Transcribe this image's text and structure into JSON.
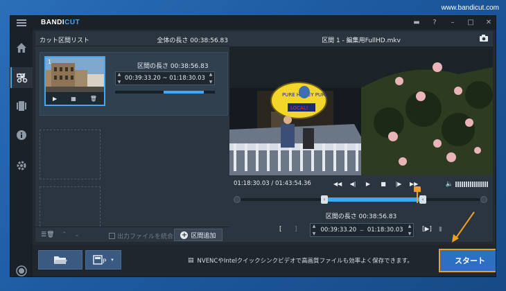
{
  "watermark": "www.bandicut.com",
  "app": {
    "logo_a": "BANDI",
    "logo_b": "CUT"
  },
  "sidebar": [
    "home-icon",
    "cut-icon",
    "film-icon",
    "info-icon",
    "gear-icon",
    "record-icon"
  ],
  "left_panel": {
    "title": "カット区間リスト",
    "total_length": "全体の長さ 00:38:56.83",
    "clip": {
      "index": "1",
      "length_label": "区間の長さ 00:38:56.83",
      "time_range": "00:39:33.20 ~ 01:18:30.03",
      "progress": 0.4
    },
    "merge_label": "出力ファイルを統合",
    "add_label": "区間追加"
  },
  "player": {
    "title": "区間 1 - 編集用FullHD.mkv",
    "position": "01:18:30.03 / 01:43:54.36",
    "segment_length": "区間の長さ 00:38:56.83",
    "segment_start": "00:39:33.20",
    "segment_end": "01:18:30.03",
    "sign_top": "PURE HONEY PURE",
    "sign_bottom": "LOCAL!"
  },
  "bottom": {
    "tip": "NVENCやIntelクイックシンクビデオで高画質ファイルも効率よく保存できます。",
    "start_label": "スタート"
  },
  "colors": {
    "accent": "#3fa9f5",
    "highlight": "#f0a020",
    "start_bg": "#2d6fc0"
  }
}
